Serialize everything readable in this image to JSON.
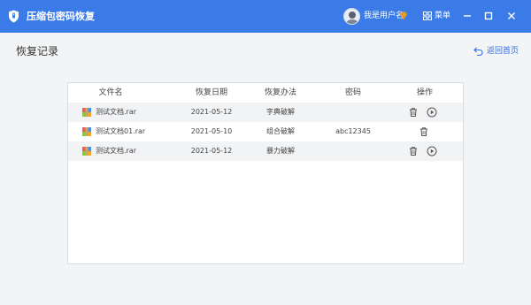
{
  "app": {
    "title": "压缩包密码恢复",
    "user": {
      "name": "我是用户名"
    },
    "menu_label": "菜单"
  },
  "page": {
    "title": "恢复记录",
    "back_label": "返回首页"
  },
  "table": {
    "headers": {
      "filename": "文件名",
      "date": "恢复日期",
      "method": "恢复办法",
      "password": "密码",
      "actions": "操作"
    },
    "rows": [
      {
        "filename": "测试文档.rar",
        "date": "2021-05-12",
        "method": "字典破解",
        "password": "",
        "actions": [
          "delete",
          "play"
        ]
      },
      {
        "filename": "测试文档01.rar",
        "date": "2021-05-10",
        "method": "组合破解",
        "password": "abc12345",
        "actions": [
          "delete"
        ]
      },
      {
        "filename": "测试文档.rar",
        "date": "2021-05-12",
        "method": "暴力破解",
        "password": "",
        "actions": [
          "delete",
          "play"
        ]
      }
    ]
  },
  "colors": {
    "accent": "#3b7be8",
    "link": "#2f6fe0",
    "row_alt": "#f2f3f5"
  },
  "icons": [
    "shield-icon",
    "vip-icon",
    "menu-grid-icon",
    "minimize-icon",
    "maximize-icon",
    "close-icon",
    "back-arrow-icon",
    "file-icon",
    "trash-icon",
    "play-icon"
  ]
}
